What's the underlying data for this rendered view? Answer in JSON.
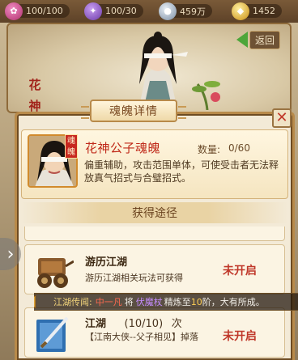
{
  "resources": {
    "stamina": "100/100",
    "energy": "100/30",
    "silver": "459万",
    "gold": "1452"
  },
  "back_label": "返回",
  "side_title": "花神",
  "modal": {
    "title": "魂魄详情",
    "item_name": "花神公子魂魄",
    "soul_tag": "魂魄",
    "quantity_label": "数量:",
    "quantity_value": "0/60",
    "description": "偏重辅助，攻击范围单体，可使受击者无法释放真气招式与合璧招式。",
    "section_title": "获得途径"
  },
  "obtain_list": [
    {
      "title": "游历江湖",
      "subtitle": "游历江湖相关玩法可获得",
      "status": "未开启"
    },
    {
      "title": "江湖",
      "progress": "(10/10)",
      "unit": "次",
      "subtitle": "【江南大侠--父子相见】掉落",
      "status": "未开启"
    }
  ],
  "broadcast": {
    "label": "江湖传闻:",
    "name": "中一凡",
    "action": "将",
    "item": "伏魔杖",
    "refine": "精炼至",
    "level": "10",
    "suffix": "阶，大有所成。"
  },
  "colors": {
    "accent_red": "#c0392b",
    "frame_gold": "#b88a4a"
  }
}
